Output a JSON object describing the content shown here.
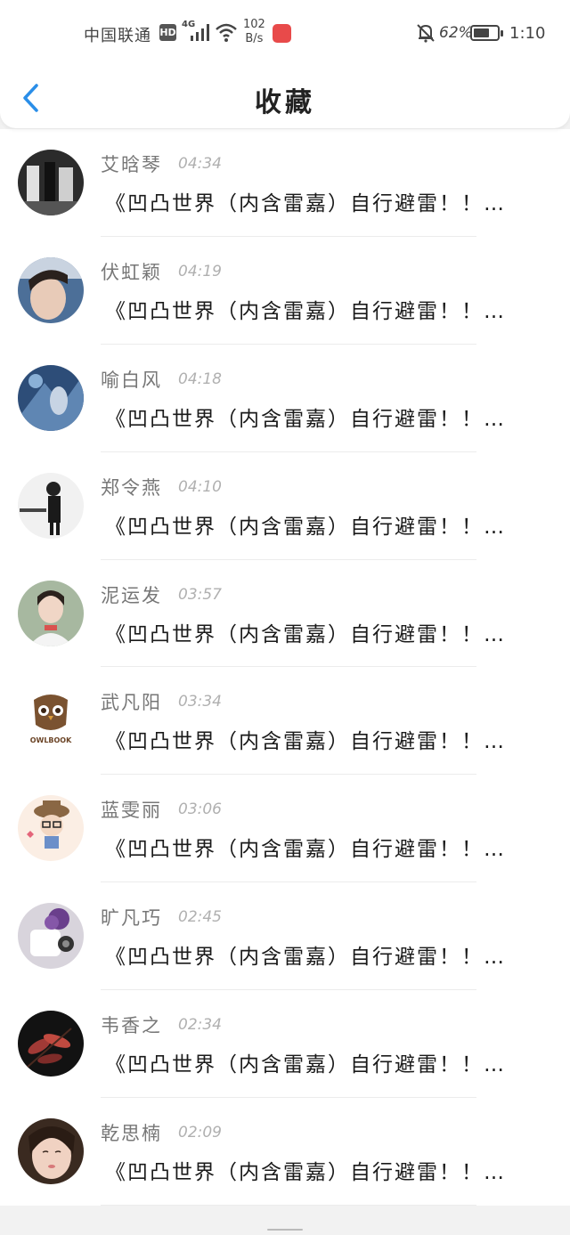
{
  "status_bar": {
    "carrier": "中国联通",
    "hd": "HD",
    "network": "4G",
    "speed_value": "102",
    "speed_unit": "B/s",
    "battery_percent": "62%",
    "battery_level": 0.62,
    "time": "1:10",
    "icons": [
      "hd-icon",
      "signal-icon",
      "wifi-icon",
      "app-badge-icon",
      "bell-muted-icon",
      "battery-icon"
    ]
  },
  "header": {
    "back_icon": "chevron-left-icon",
    "title": "收藏",
    "accent": "#2a8ee8"
  },
  "messages": [
    {
      "name": "艾晗琴",
      "time": "04:34",
      "text": "《凹凸世界（内含雷嘉）自行避雷！！…"
    },
    {
      "name": "伏虹颖",
      "time": "04:19",
      "text": "《凹凸世界（内含雷嘉）自行避雷！！…"
    },
    {
      "name": "喻白风",
      "time": "04:18",
      "text": "《凹凸世界（内含雷嘉）自行避雷！！…"
    },
    {
      "name": "郑令燕",
      "time": "04:10",
      "text": "《凹凸世界（内含雷嘉）自行避雷！！…"
    },
    {
      "name": "泥运发",
      "time": "03:57",
      "text": "《凹凸世界（内含雷嘉）自行避雷！！…"
    },
    {
      "name": "武凡阳",
      "time": "03:34",
      "text": "《凹凸世界（内含雷嘉）自行避雷！！…",
      "avatar_text": "OWLBOOK"
    },
    {
      "name": "蓝雯丽",
      "time": "03:06",
      "text": "《凹凸世界（内含雷嘉）自行避雷！！…"
    },
    {
      "name": "旷凡巧",
      "time": "02:45",
      "text": "《凹凸世界（内含雷嘉）自行避雷！！…"
    },
    {
      "name": "韦香之",
      "time": "02:34",
      "text": "《凹凸世界（内含雷嘉）自行避雷！！…"
    },
    {
      "name": "乾思楠",
      "time": "02:09",
      "text": "《凹凸世界（内含雷嘉）自行避雷！！…"
    }
  ]
}
